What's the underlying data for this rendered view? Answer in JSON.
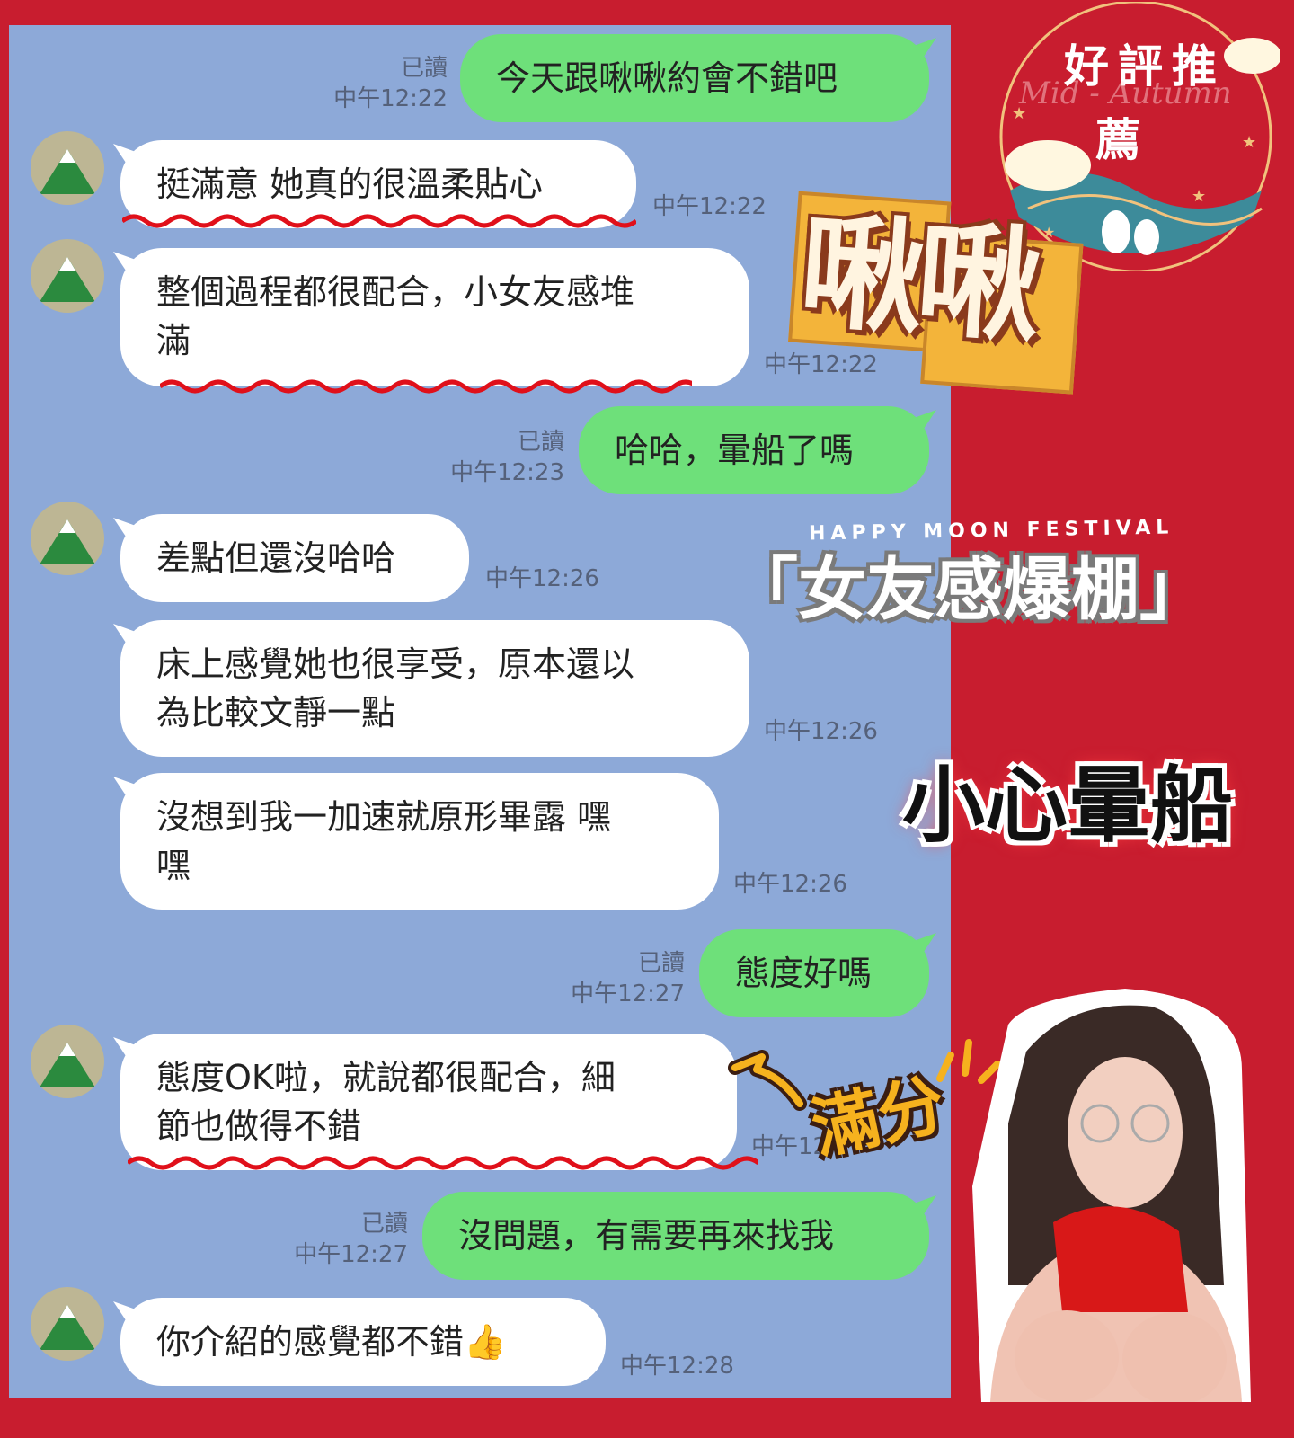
{
  "messages": [
    {
      "side": "out",
      "text": "今天跟啾啾約會不錯吧",
      "read": "已讀",
      "time": "中午12:22"
    },
    {
      "side": "in",
      "text": "挺滿意 她真的很溫柔貼心",
      "time": "中午12:22"
    },
    {
      "side": "in",
      "line1": "整個過程都很配合，小女友感堆",
      "line2": "滿",
      "time": "中午12:22"
    },
    {
      "side": "out",
      "text": "哈哈，暈船了嗎",
      "read": "已讀",
      "time": "中午12:23"
    },
    {
      "side": "in",
      "text": "差點但還沒哈哈",
      "time": "中午12:26"
    },
    {
      "side": "in",
      "line1": "床上感覺她也很享受，原本還以",
      "line2": "為比較文靜一點",
      "time": "中午12:26"
    },
    {
      "side": "in",
      "line1": "沒想到我一加速就原形畢露 嘿",
      "line2": "嘿",
      "time": "中午12:26"
    },
    {
      "side": "out",
      "text": "態度好嗎",
      "read": "已讀",
      "time": "中午12:27"
    },
    {
      "side": "in",
      "line1": "態度OK啦，就說都很配合，細",
      "line2": "節也做得不錯",
      "time": "中午12:27"
    },
    {
      "side": "out",
      "text": "沒問題，有需要再來找我",
      "read": "已讀",
      "time": "中午12:27"
    },
    {
      "side": "in",
      "text": "你介紹的感覺都不錯👍",
      "time": "中午12:28"
    }
  ],
  "decorations": {
    "badge_title_1": "好評推",
    "badge_title_2": "薦",
    "badge_script": "Mid - Autumn",
    "name_sticker": "啾啾",
    "happy_moon": "HAPPY MOON FESTIVAL",
    "girlfriend_text": "「女友感爆棚」",
    "caution_text": "小心暈船",
    "score_text": "滿分"
  },
  "colors": {
    "background": "#c81d2f",
    "chat_bg": "#8da9d8",
    "outgoing_bubble": "#6ee07a",
    "incoming_bubble": "#ffffff",
    "underline": "#e0101a"
  }
}
